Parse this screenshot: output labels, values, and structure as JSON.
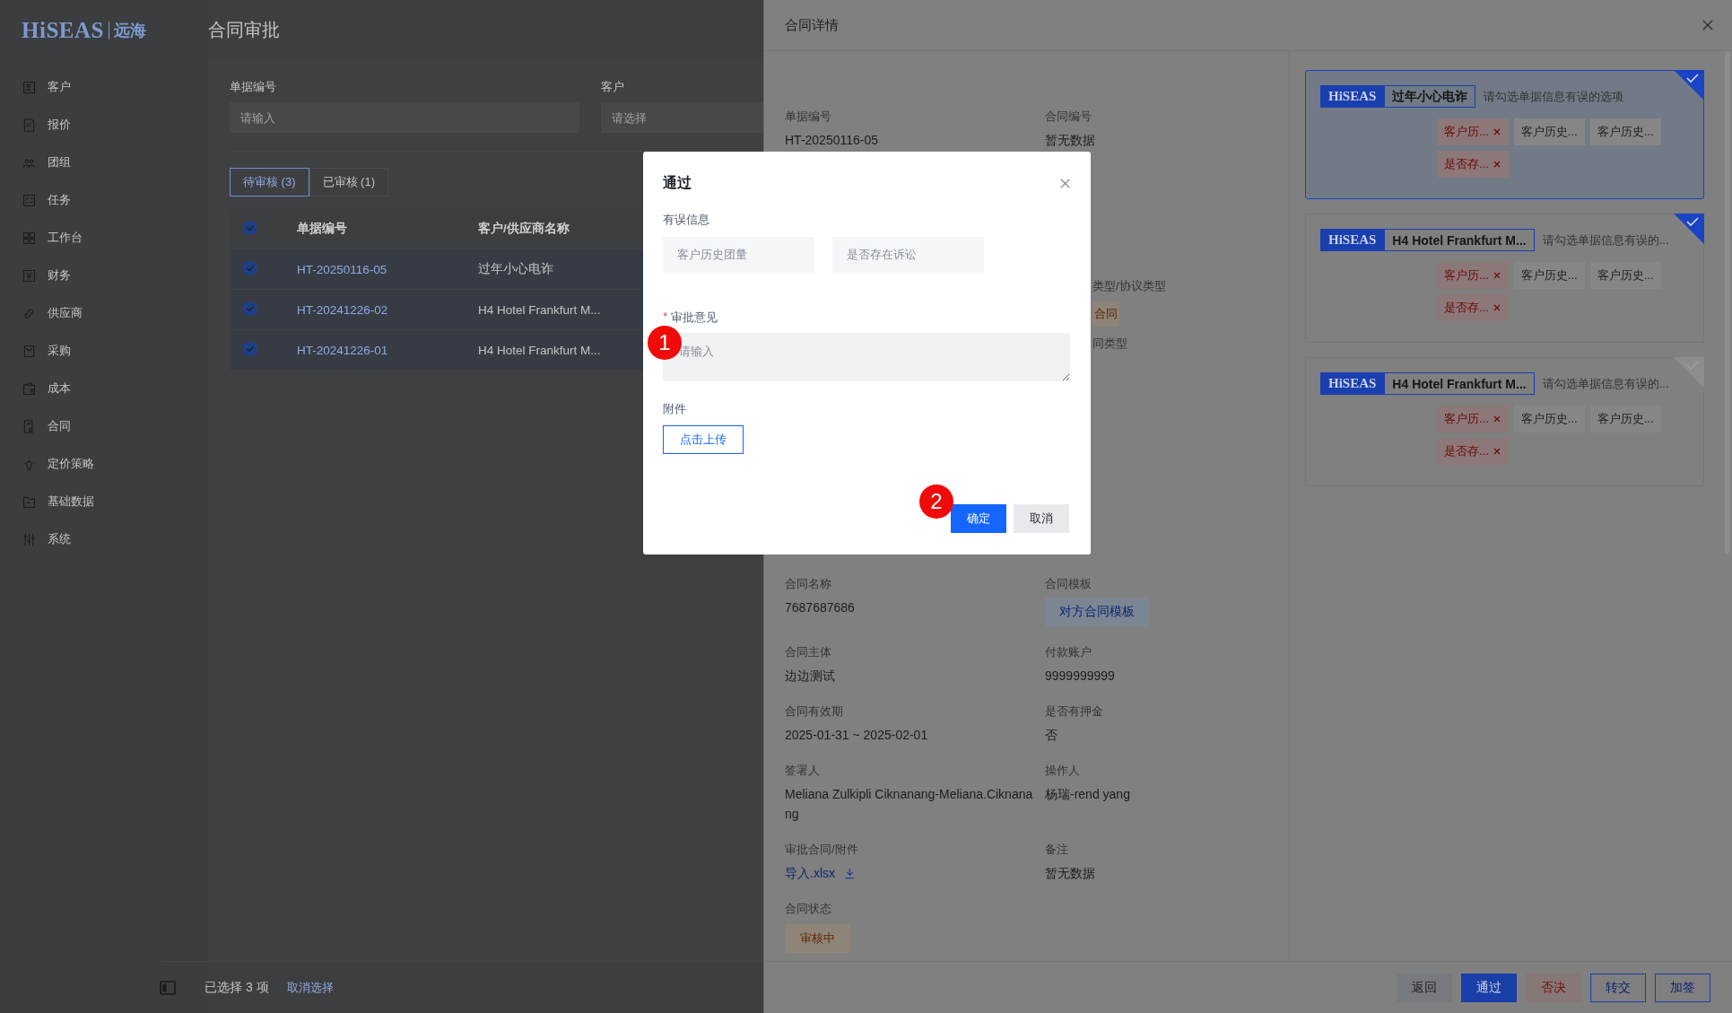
{
  "logo": {
    "latin": "HiSEAS",
    "chinese": "远海"
  },
  "page_title": "合同审批",
  "sidebar": {
    "items": [
      {
        "label": "客户"
      },
      {
        "label": "报价"
      },
      {
        "label": "团组"
      },
      {
        "label": "任务"
      },
      {
        "label": "工作台"
      },
      {
        "label": "财务"
      },
      {
        "label": "供应商"
      },
      {
        "label": "采购"
      },
      {
        "label": "成本"
      },
      {
        "label": "合同"
      },
      {
        "label": "定价策略"
      },
      {
        "label": "基础数据"
      },
      {
        "label": "系统"
      }
    ]
  },
  "filters": [
    {
      "label": "单据编号",
      "placeholder": "请输入"
    },
    {
      "label": "客户",
      "placeholder": "请选择"
    }
  ],
  "tabs": [
    {
      "label": "待审核 (3)",
      "selected": true
    },
    {
      "label": "已审核 (1)",
      "selected": false
    }
  ],
  "table": {
    "header_checked": true,
    "columns": [
      "单据编号",
      "客户/供应商名称"
    ],
    "rows": [
      {
        "checked": true,
        "number": "HT-20250116-05",
        "name": "过年小心电诈"
      },
      {
        "checked": true,
        "number": "HT-20241226-02",
        "name": "H4 Hotel Frankfurt M..."
      },
      {
        "checked": true,
        "number": "HT-20241226-01",
        "name": "H4 Hotel Frankfurt M..."
      }
    ]
  },
  "selection_bar": {
    "text": "已选择 3 项",
    "clear_link": "取消选择"
  },
  "drawer": {
    "title": "合同详情",
    "top_fields": [
      {
        "label": "单据编号",
        "value": "HT-20250116-05"
      },
      {
        "label": "合同编号",
        "value": "暂无数据"
      }
    ],
    "partial_fields": [
      {
        "label": "类型/协议类型",
        "tag": "合同"
      },
      {
        "label": "同类型"
      }
    ],
    "fields": [
      {
        "kind": "text",
        "label": "合同名称",
        "value": "7687687686"
      },
      {
        "kind": "template",
        "label": "合同模板",
        "value": "对方合同模板"
      },
      {
        "kind": "text",
        "label": "合同主体",
        "value": "边边测试"
      },
      {
        "kind": "text",
        "label": "付款账户",
        "value": "9999999999"
      },
      {
        "kind": "text",
        "label": "合同有效期",
        "value": "2025-01-31 ~ 2025-02-01"
      },
      {
        "kind": "text",
        "label": "是否有押金",
        "value": "否"
      },
      {
        "kind": "text",
        "label": "签署人",
        "value": "Meliana Zulkipli Ciknanang-Meliana.Ciknanang"
      },
      {
        "kind": "text",
        "label": "操作人",
        "value": "杨瑞-rend yang"
      },
      {
        "kind": "file",
        "label": "审批合同/附件",
        "value": "导入.xlsx"
      },
      {
        "kind": "text",
        "label": "备注",
        "value": "暂无数据"
      },
      {
        "kind": "status",
        "label": "合同状态",
        "value": "审核中"
      }
    ],
    "buttons": [
      {
        "kind": "default",
        "label": "返回"
      },
      {
        "kind": "primary",
        "label": "通过"
      },
      {
        "kind": "danger",
        "label": "否决"
      },
      {
        "kind": "outline",
        "label": "转交"
      },
      {
        "kind": "outline",
        "label": "加签"
      }
    ]
  },
  "review_cards": [
    {
      "selected": true,
      "checked": true,
      "logo": "HiSEAS",
      "name": "过年小心电诈",
      "hint": "请勾选单据信息有误的选项",
      "tags": [
        {
          "label": "客户历...",
          "marked": true
        },
        {
          "label": "客户历史...",
          "marked": false
        },
        {
          "label": "客户历史...",
          "marked": false
        },
        {
          "label": "是否存...",
          "marked": true
        }
      ]
    },
    {
      "selected": false,
      "checked": true,
      "logo": "HiSEAS",
      "name": "H4 Hotel Frankfurt M...",
      "hint": "请勾选单据信息有误的...",
      "tags": [
        {
          "label": "客户历...",
          "marked": true
        },
        {
          "label": "客户历史...",
          "marked": false
        },
        {
          "label": "客户历史...",
          "marked": false
        },
        {
          "label": "是否存...",
          "marked": true
        }
      ]
    },
    {
      "selected": false,
      "checked": false,
      "logo": "HiSEAS",
      "name": "H4 Hotel Frankfurt M...",
      "hint": "请勾选单据信息有误的...",
      "tags": [
        {
          "label": "客户历...",
          "marked": true
        },
        {
          "label": "客户历史...",
          "marked": false
        },
        {
          "label": "客户历史...",
          "marked": false
        },
        {
          "label": "是否存...",
          "marked": true
        }
      ]
    }
  ],
  "modal": {
    "title": "通过",
    "error_label": "有误信息",
    "error_items": [
      "客户历史团量",
      "是否存在诉讼"
    ],
    "comment": {
      "required_mark": "*",
      "label": "审批意见",
      "placeholder": "请输入"
    },
    "attachment_label": "附件",
    "upload_button": "点击上传",
    "buttons": [
      {
        "kind": "primary",
        "label": "确定"
      },
      {
        "kind": "default",
        "label": "取消"
      }
    ]
  },
  "markers": [
    "1",
    "2"
  ]
}
